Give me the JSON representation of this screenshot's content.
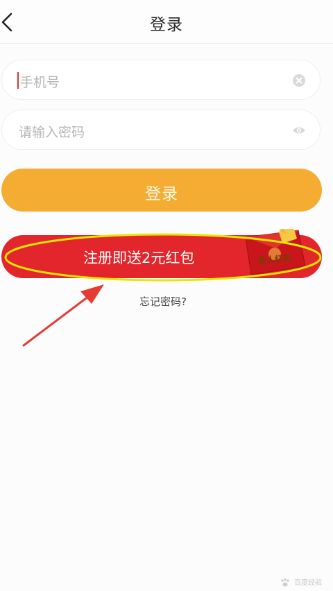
{
  "header": {
    "title": "登录",
    "back_icon": "chevron-left-icon"
  },
  "form": {
    "phone": {
      "placeholder": "手机号",
      "clear_icon": "clear-circle-icon"
    },
    "password": {
      "placeholder": "请输入密码",
      "toggle_icon": "eye-icon"
    },
    "login_label": "登录",
    "register_label": "注册即送2元红包",
    "red_packet_badge": "新人红包",
    "forgot_label": "忘记密码?"
  },
  "annotation": {
    "highlight": "yellow-ellipse",
    "arrow": "red-arrow"
  },
  "watermark": "百度经验",
  "colors": {
    "login_button": "#f4ad32",
    "register_button": "#e2262c",
    "highlight": "#e8e600",
    "arrow": "#e63a35",
    "cursor": "#e3312a"
  }
}
